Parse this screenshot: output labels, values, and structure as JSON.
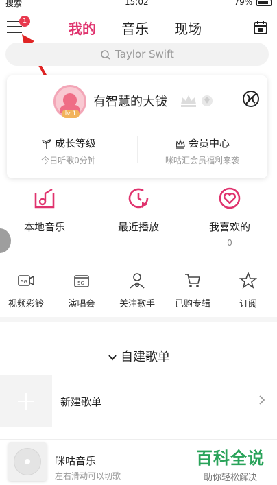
{
  "status_bar": {
    "carrier": "搜索",
    "time": "15:02",
    "battery": "79%"
  },
  "topbar": {
    "menu_badge": "1",
    "tabs": [
      {
        "label": "我的",
        "active": true
      },
      {
        "label": "音乐",
        "active": false
      },
      {
        "label": "现场",
        "active": false
      }
    ],
    "calendar_icon": "calendar-icon"
  },
  "search": {
    "placeholder": "Taylor Swift"
  },
  "profile": {
    "username": "有智慧的大钹",
    "level": "lv 1",
    "growth": {
      "title": "成长等级",
      "subtitle": "今日听歌0分钟"
    },
    "vip": {
      "title": "会员中心",
      "subtitle": "咪咕汇会员福利来袭"
    }
  },
  "quick": [
    {
      "label": "本地音乐",
      "icon": "local-music-icon"
    },
    {
      "label": "最近播放",
      "icon": "recent-play-icon"
    },
    {
      "label": "我喜欢的",
      "icon": "favorite-icon",
      "count": "0"
    }
  ],
  "services": [
    {
      "label": "视频彩铃",
      "icon": "video-ringtone-icon"
    },
    {
      "label": "演唱会",
      "icon": "concert-icon"
    },
    {
      "label": "关注歌手",
      "icon": "follow-singer-icon"
    },
    {
      "label": "已购专辑",
      "icon": "purchased-album-icon"
    },
    {
      "label": "订阅",
      "icon": "subscribe-icon"
    }
  ],
  "playlists": {
    "header": "自建歌单",
    "new_label": "新建歌单"
  },
  "player": {
    "title": "咪咕音乐",
    "subtitle": "左右滑动可以切歌"
  },
  "watermark": {
    "title": "百科全说",
    "subtitle": "助你轻松解决"
  },
  "colors": {
    "accent": "#e0336e",
    "badge": "#e8394e",
    "watermark": "#2aa35a"
  }
}
